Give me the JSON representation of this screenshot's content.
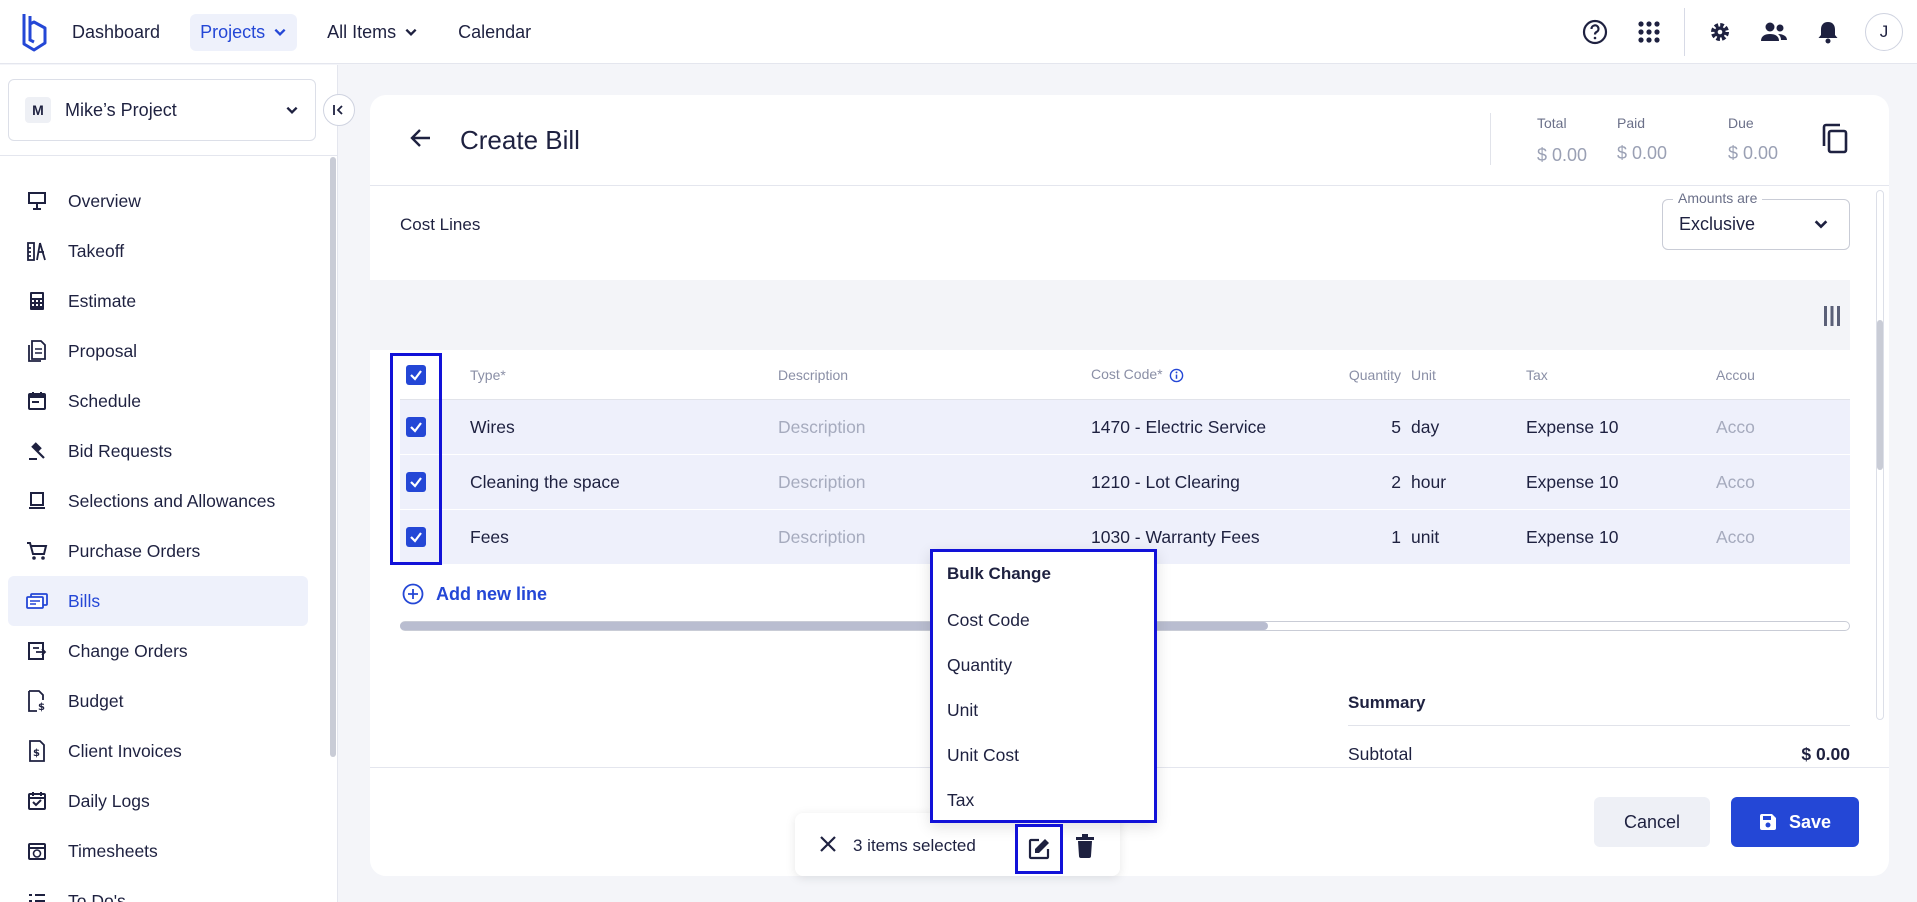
{
  "topnav": {
    "dashboard": "Dashboard",
    "projects": "Projects",
    "all_items": "All Items",
    "calendar": "Calendar",
    "avatar_initial": "J"
  },
  "sidebar": {
    "project_badge": "M",
    "project_name": "Mike’s Project",
    "items": [
      {
        "label": "Overview",
        "icon": "presentation-icon"
      },
      {
        "label": "Takeoff",
        "icon": "ruler-icon"
      },
      {
        "label": "Estimate",
        "icon": "calculator-icon"
      },
      {
        "label": "Proposal",
        "icon": "document-icon"
      },
      {
        "label": "Schedule",
        "icon": "calendar-icon"
      },
      {
        "label": "Bid Requests",
        "icon": "gavel-icon"
      },
      {
        "label": "Selections and Allowances",
        "icon": "monitor-icon"
      },
      {
        "label": "Purchase Orders",
        "icon": "cart-icon"
      },
      {
        "label": "Bills",
        "icon": "bills-icon",
        "active": true
      },
      {
        "label": "Change Orders",
        "icon": "change-icon"
      },
      {
        "label": "Budget",
        "icon": "budget-icon"
      },
      {
        "label": "Client Invoices",
        "icon": "invoice-icon"
      },
      {
        "label": "Daily Logs",
        "icon": "log-icon"
      },
      {
        "label": "Timesheets",
        "icon": "timesheet-icon"
      },
      {
        "label": "To Do's",
        "icon": "todo-icon"
      }
    ]
  },
  "header": {
    "title": "Create Bill",
    "total_label": "Total",
    "total_value": "$ 0.00",
    "paid_label": "Paid",
    "paid_value": "$ 0.00",
    "due_label": "Due",
    "due_value": "$ 0.00"
  },
  "cost_lines": {
    "title": "Cost Lines",
    "amounts_label": "Amounts are",
    "amounts_value": "Exclusive",
    "columns": [
      "Type*",
      "Description",
      "Cost Code*",
      "Quantity",
      "Unit",
      "Tax",
      "Accou"
    ],
    "rows": [
      {
        "type": "Wires",
        "description": "Description",
        "cost_code": "1470 - Electric Service",
        "quantity": "5",
        "unit": "day",
        "tax": "Expense 10",
        "account": "Accou"
      },
      {
        "type": "Cleaning the space",
        "description": "Description",
        "cost_code": "1210 - Lot Clearing",
        "quantity": "2",
        "unit": "hour",
        "tax": "Expense 10",
        "account": "Accou"
      },
      {
        "type": "Fees",
        "description": "Description",
        "cost_code": "1030 - Warranty Fees",
        "quantity": "1",
        "unit": "unit",
        "tax": "Expense 10",
        "account": "Accou"
      }
    ],
    "add_line": "Add new line"
  },
  "summary": {
    "title": "Summary",
    "subtotal_label": "Subtotal",
    "subtotal_value": "$ 0.00"
  },
  "footer": {
    "cancel": "Cancel",
    "save": "Save"
  },
  "bulk_menu": {
    "title": "Bulk Change",
    "items": [
      "Cost Code",
      "Quantity",
      "Unit",
      "Unit Cost",
      "Tax"
    ]
  },
  "selection_bar": {
    "text": "3 items selected"
  },
  "colors": {
    "accent": "#2447d6",
    "highlight_border": "#1212d8",
    "row_selected": "#eef0fb"
  }
}
